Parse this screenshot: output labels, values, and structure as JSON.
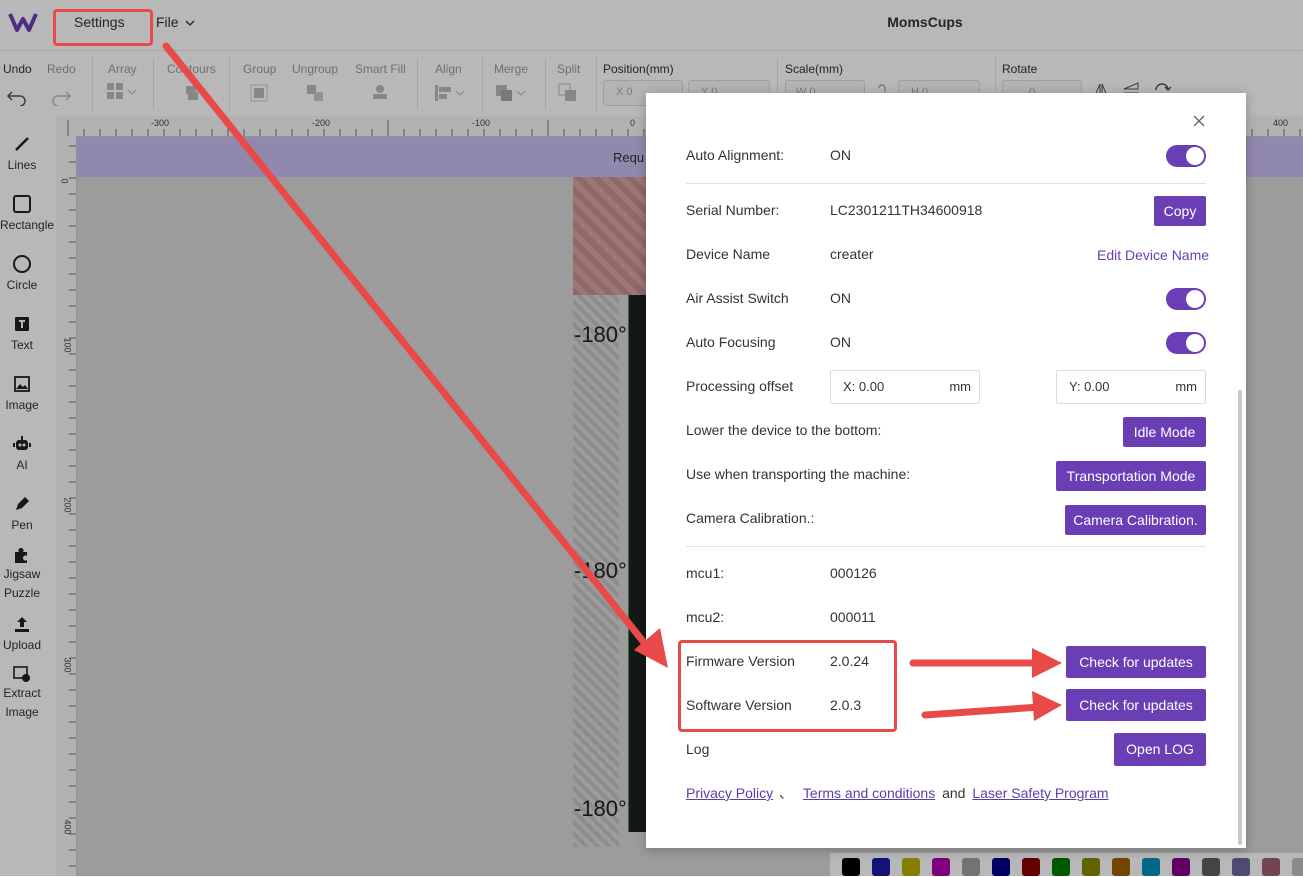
{
  "topbar": {
    "app_title": "MomsCups",
    "menu": [
      {
        "label": "Settings"
      },
      {
        "label": "File"
      }
    ]
  },
  "toolbar": {
    "undo": "Undo",
    "redo": "Redo",
    "array": "Array",
    "contours": "Contours",
    "group": "Group",
    "ungroup": "Ungroup",
    "smart_fill": "Smart Fill",
    "align": "Align",
    "merge": "Merge",
    "split": "Split",
    "position": "Position(mm)",
    "scale": "Scale(mm)",
    "rotate": "Rotate",
    "pos_x": "X 0",
    "pos_y": "Y 0",
    "scale_w": "W 0",
    "scale_h": "H 0",
    "rotate_val": "0"
  },
  "tools": [
    {
      "label": "Lines",
      "icon": "line-icon"
    },
    {
      "label": "Rectangle",
      "icon": "rectangle-icon"
    },
    {
      "label": "Circle",
      "icon": "circle-icon"
    },
    {
      "label": "Text",
      "icon": "text-icon"
    },
    {
      "label": "Image",
      "icon": "image-icon"
    },
    {
      "label": "AI",
      "icon": "robot-icon"
    },
    {
      "label": "Pen",
      "icon": "pen-icon"
    },
    {
      "label": "Jigsaw Puzzle",
      "icon": "puzzle-icon"
    },
    {
      "label": "Upload",
      "icon": "upload-icon"
    },
    {
      "label": "Extract Image",
      "icon": "extract-image-icon"
    }
  ],
  "rulers": {
    "h": [
      "-300",
      "-200",
      "-100",
      "0",
      "400"
    ],
    "v": [
      "0",
      "100",
      "200",
      "300",
      "400"
    ]
  },
  "canvas": {
    "banner": "Requ",
    "degrees": [
      "-180°",
      "-180°",
      "-180°"
    ]
  },
  "dialog": {
    "auto_alignment": {
      "label": "Auto Alignment:",
      "value": "ON"
    },
    "serial": {
      "label": "Serial Number:",
      "value": "LC2301211TH34600918",
      "button": "Copy"
    },
    "device_name": {
      "label": "Device Name",
      "value": "creater",
      "link": "Edit Device Name"
    },
    "air_assist": {
      "label": "Air Assist Switch",
      "value": "ON"
    },
    "auto_focusing": {
      "label": "Auto Focusing",
      "value": "ON"
    },
    "offset": {
      "label": "Processing offset",
      "x": "X: 0.00",
      "y": "Y: 0.00",
      "unit": "mm"
    },
    "lower": {
      "label": "Lower the device to the bottom:",
      "button": "Idle Mode"
    },
    "transport": {
      "label": "Use when transporting the machine:",
      "button": "Transportation Mode"
    },
    "camera": {
      "label": "Camera Calibration.:",
      "button": "Camera Calibration."
    },
    "mcu1": {
      "label": "mcu1:",
      "value": "000126"
    },
    "mcu2": {
      "label": "mcu2:",
      "value": "000011"
    },
    "firmware": {
      "label": "Firmware Version",
      "value": "2.0.24",
      "button": "Check for updates"
    },
    "software": {
      "label": "Software Version",
      "value": "2.0.3",
      "button": "Check for updates"
    },
    "log": {
      "label": "Log",
      "button": "Open LOG"
    },
    "footer": {
      "privacy": "Privacy Policy",
      "sep": "、",
      "terms": "Terms and conditions",
      "and": "and",
      "safety": "Laser Safety Program"
    }
  },
  "palette": [
    "#000000",
    "#1a1aa8",
    "#b8b000",
    "#b000b0",
    "#a0a0a0",
    "#00008a",
    "#8a0000",
    "#007a00",
    "#8a8a00",
    "#a06000",
    "#0090c0",
    "#8a008a",
    "#606060",
    "#6a6aa0",
    "#a06070",
    "#c0c0c0"
  ],
  "colors": {
    "accent": "#6a3fb6",
    "annotation": "#e84a4a"
  }
}
